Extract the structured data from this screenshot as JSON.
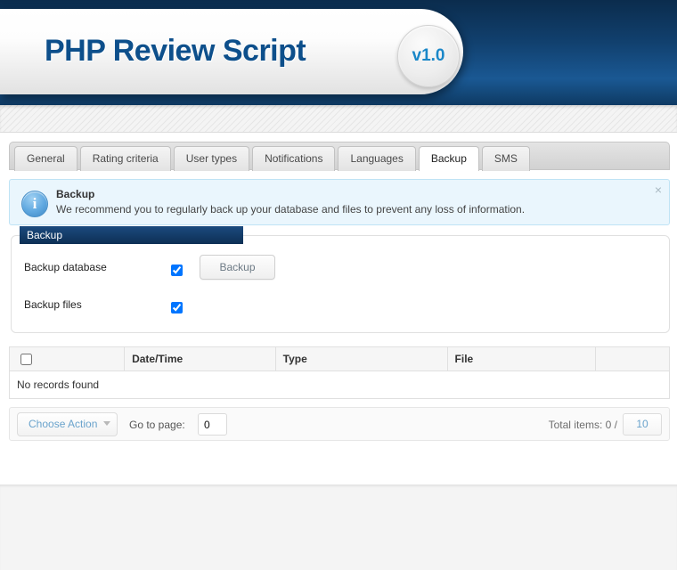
{
  "header": {
    "brand_title": "PHP Review Script",
    "version_badge": "v1.0",
    "brand_color": "#0d4f8b",
    "badge_color": "#1a87c8",
    "bg_color": "#11406e"
  },
  "tabs": [
    {
      "label": "General",
      "active": false
    },
    {
      "label": "Rating criteria",
      "active": false
    },
    {
      "label": "User types",
      "active": false
    },
    {
      "label": "Notifications",
      "active": false
    },
    {
      "label": "Languages",
      "active": false
    },
    {
      "label": "Backup",
      "active": true
    },
    {
      "label": "SMS",
      "active": false
    }
  ],
  "info_panel": {
    "icon": "info-icon",
    "title": "Backup",
    "text": "We recommend you to regularly back up your database and files to prevent any loss of information.",
    "close_label": "×",
    "bg_color": "#eaf6fd",
    "border_color": "#bfe3f5"
  },
  "fieldset": {
    "legend": "Backup",
    "legend_bg": "#0d2f55",
    "rows": [
      {
        "label": "Backup database",
        "checked": true
      },
      {
        "label": "Backup files",
        "checked": true
      }
    ],
    "button_label": "Backup"
  },
  "table": {
    "select_all_checked": false,
    "columns": [
      "",
      "Date/Time",
      "Type",
      "File",
      ""
    ],
    "empty_message": "No records found",
    "rows": []
  },
  "toolbar": {
    "choose_action_label": "Choose Action",
    "goto_label": "Go to page:",
    "goto_value": "0",
    "total_items_label": "Total items: 0 /",
    "per_page_value": "10"
  }
}
